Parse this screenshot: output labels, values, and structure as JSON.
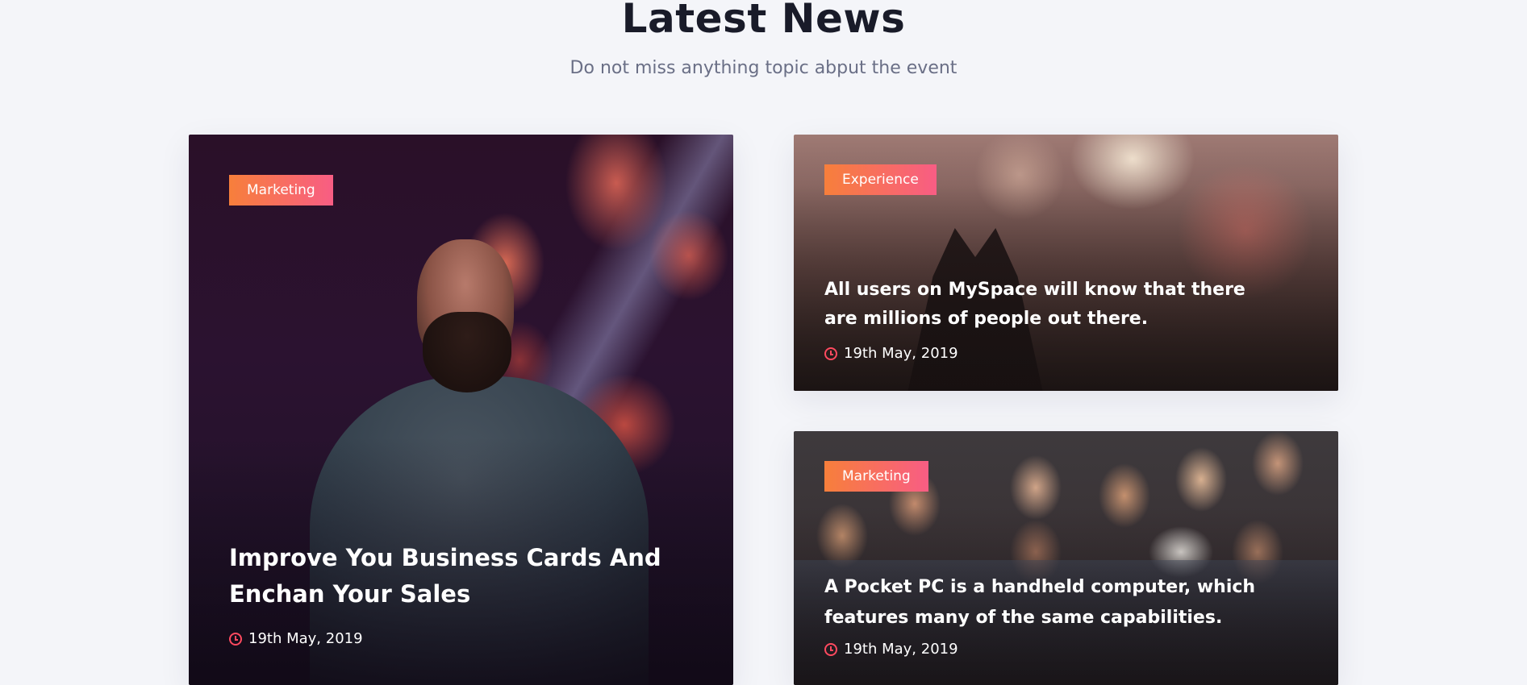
{
  "header": {
    "title": "Latest News",
    "subtitle": "Do not miss anything topic abput the event"
  },
  "cards": [
    {
      "tag": "Marketing",
      "title": "Improve You Business Cards And Enchan Your Sales",
      "date": "19th May, 2019",
      "icon": "clock-icon"
    },
    {
      "tag": "Experience",
      "title": "All users on MySpace will know that there are millions of people out there.",
      "date": "19th May, 2019",
      "icon": "clock-icon"
    },
    {
      "tag": "Marketing",
      "title": "A Pocket PC is a handheld computer, which features many of the same capabilities.",
      "date": "19th May, 2019",
      "icon": "clock-icon"
    }
  ],
  "colors": {
    "accent_start": "#f77f3b",
    "accent_end": "#f85d84",
    "icon": "#ff4a5f",
    "title": "#191b29",
    "subtitle": "#6a6f86",
    "background": "#f4f5f9"
  }
}
